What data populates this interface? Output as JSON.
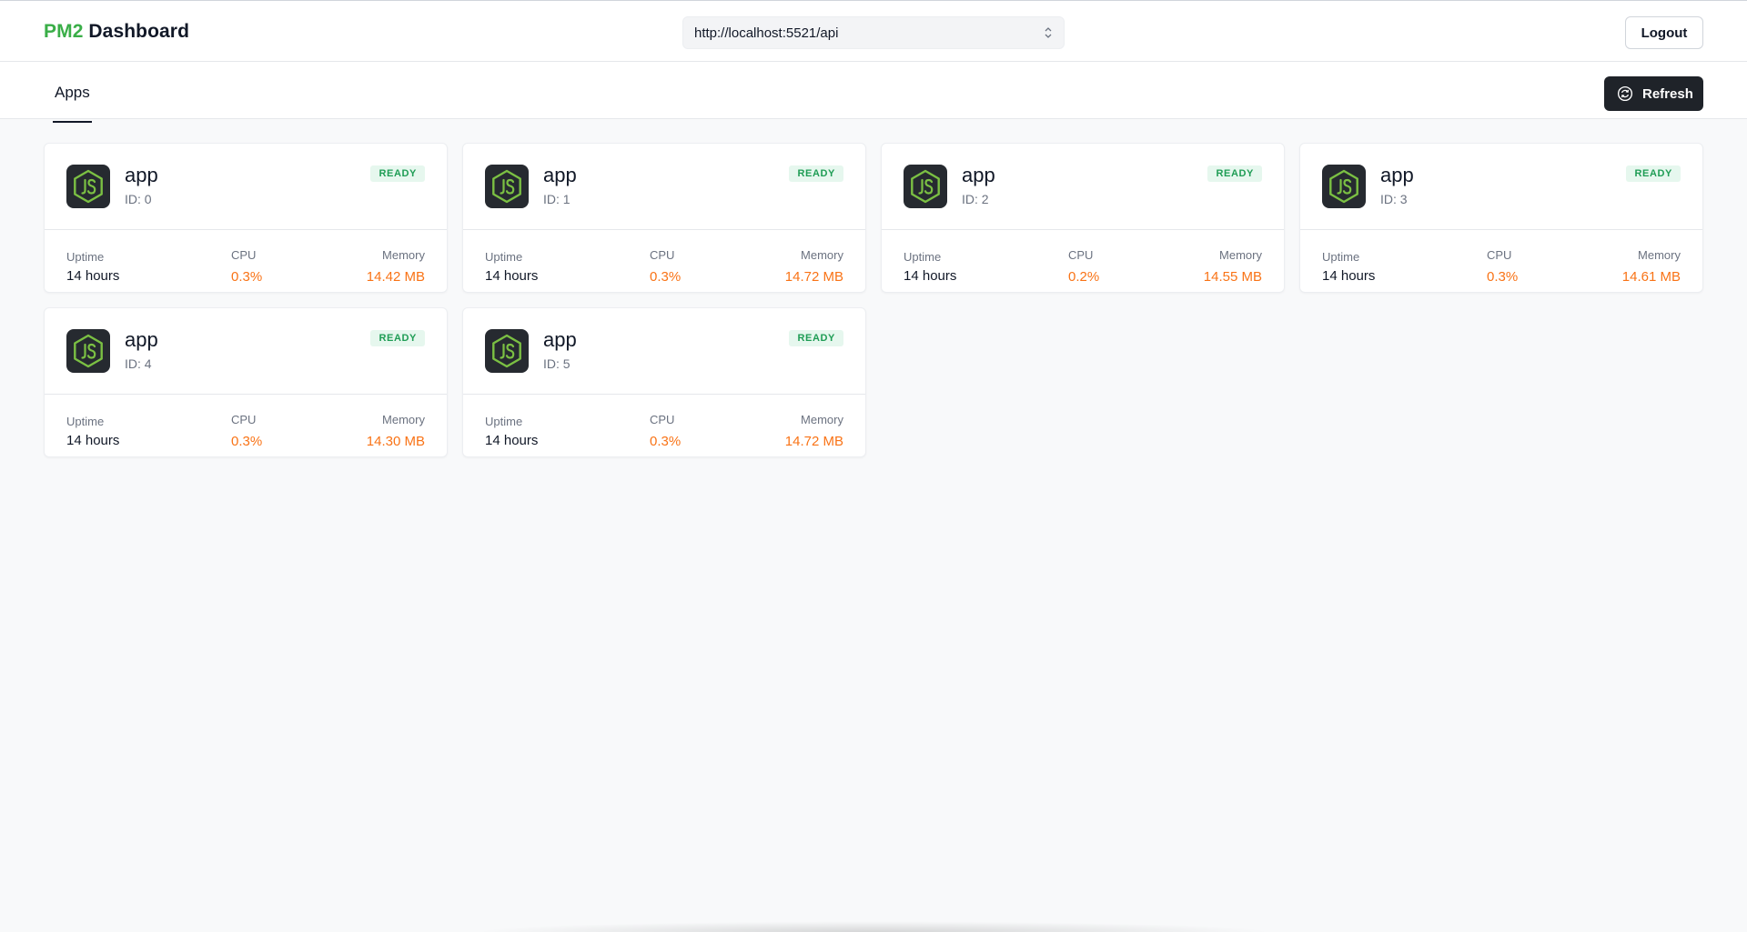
{
  "header": {
    "brand_pm2": "PM2",
    "brand_dashboard": "Dashboard",
    "server_url": "http://localhost:5521/api",
    "logout_label": "Logout"
  },
  "tabs": {
    "apps_label": "Apps",
    "refresh_label": "Refresh"
  },
  "labels": {
    "uptime": "Uptime",
    "cpu": "CPU",
    "memory": "Memory"
  },
  "colors": {
    "brand_green": "#3aae48",
    "metric_orange": "#f97316",
    "status_green": "#1f9d55"
  },
  "apps": [
    {
      "name": "app",
      "id": "ID: 0",
      "status": "READY",
      "uptime": "14 hours",
      "cpu": "0.3%",
      "memory": "14.42 MB",
      "icon": "nodejs-icon"
    },
    {
      "name": "app",
      "id": "ID: 1",
      "status": "READY",
      "uptime": "14 hours",
      "cpu": "0.3%",
      "memory": "14.72 MB",
      "icon": "nodejs-icon"
    },
    {
      "name": "app",
      "id": "ID: 2",
      "status": "READY",
      "uptime": "14 hours",
      "cpu": "0.2%",
      "memory": "14.55 MB",
      "icon": "nodejs-icon"
    },
    {
      "name": "app",
      "id": "ID: 3",
      "status": "READY",
      "uptime": "14 hours",
      "cpu": "0.3%",
      "memory": "14.61 MB",
      "icon": "nodejs-icon"
    },
    {
      "name": "app",
      "id": "ID: 4",
      "status": "READY",
      "uptime": "14 hours",
      "cpu": "0.3%",
      "memory": "14.30 MB",
      "icon": "nodejs-icon"
    },
    {
      "name": "app",
      "id": "ID: 5",
      "status": "READY",
      "uptime": "14 hours",
      "cpu": "0.3%",
      "memory": "14.72 MB",
      "icon": "nodejs-icon"
    }
  ]
}
